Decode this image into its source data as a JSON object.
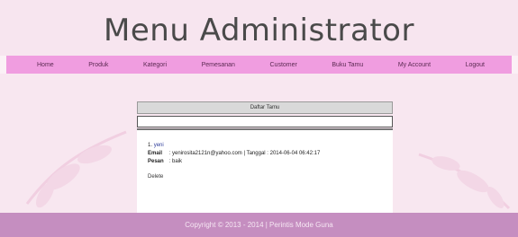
{
  "header": {
    "title": "Menu Administrator"
  },
  "nav": [
    {
      "label": "Home"
    },
    {
      "label": "Produk"
    },
    {
      "label": "Kategori"
    },
    {
      "label": "Pemesanan"
    },
    {
      "label": "Customer"
    },
    {
      "label": "Buku Tamu"
    },
    {
      "label": "My Account"
    },
    {
      "label": "Logout"
    }
  ],
  "guestbook": {
    "heading": "Daftar Tamu",
    "entries": [
      {
        "number": "1.",
        "name": "yeni",
        "email_label": "Email",
        "email": ": yenirosita2121n@yahoo.com | Tanggal : 2014-06-04 06:42:17",
        "message_label": "Pesan",
        "message": ": baik",
        "delete_label": "Delete"
      }
    ]
  },
  "footer": {
    "text": "Copyright © 2013 - 2014 | Perintis Mode Guna"
  }
}
